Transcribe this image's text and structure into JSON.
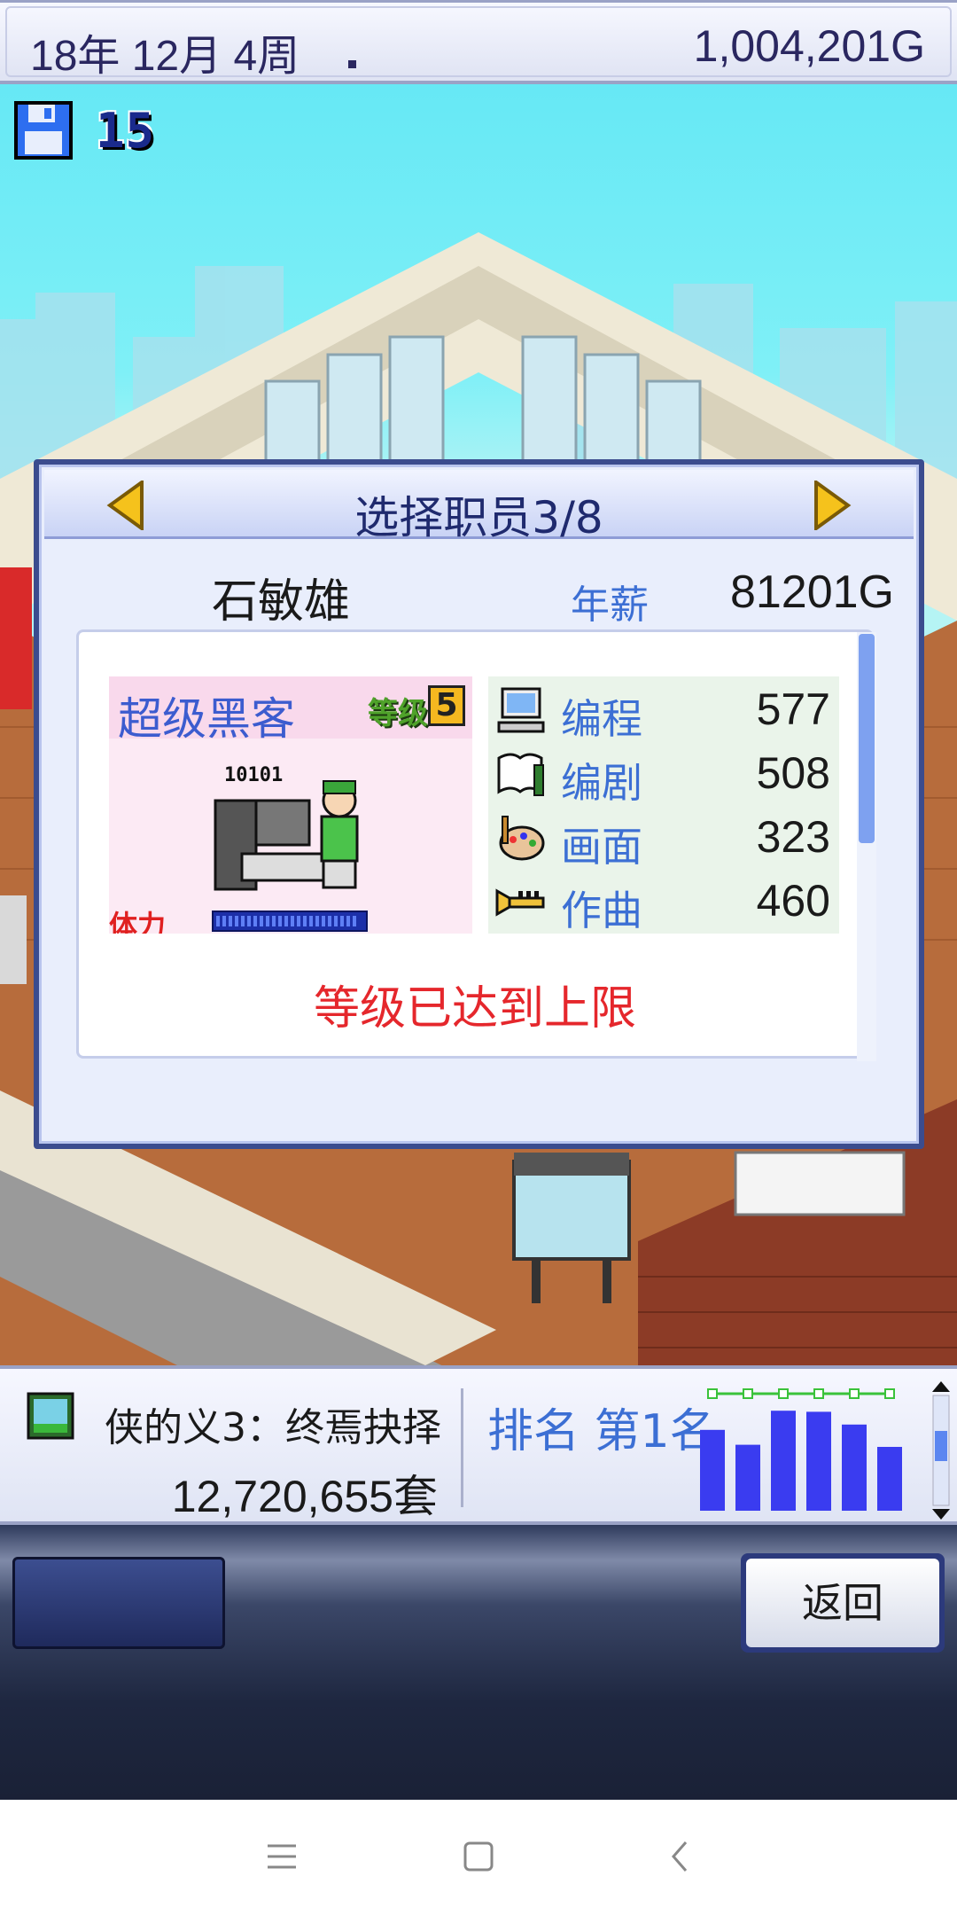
{
  "status_bar": {
    "date": "18年 12月 4周",
    "money": "1,004,201G"
  },
  "save": {
    "icon": "floppy-disk-icon",
    "count": "15"
  },
  "dialog": {
    "title": "选择职员3/8",
    "employee": {
      "name": "石敏雄",
      "salary_label": "年薪",
      "salary": "81201G",
      "job": "超级黑客",
      "level_label": "等级",
      "level": "5",
      "stamina_label": "体力",
      "stamina_fraction": 0.97,
      "art_text": "10101",
      "stats": [
        {
          "icon": "computer-icon",
          "label": "编程",
          "value": "577"
        },
        {
          "icon": "script-book-icon",
          "label": "编剧",
          "value": "508"
        },
        {
          "icon": "paint-palette-icon",
          "label": "画面",
          "value": "323"
        },
        {
          "icon": "trumpet-icon",
          "label": "作曲",
          "value": "460"
        }
      ],
      "status_message": "等级已达到上限"
    }
  },
  "info_bar": {
    "game_title": "侠的义3：终焉抉择",
    "sales": "12,720,655套",
    "rank": "排名 第1名",
    "sales_bars": [
      0.76,
      0.62,
      0.94,
      0.93,
      0.81,
      0.6
    ]
  },
  "bottom_panel": {
    "back_label": "返回"
  },
  "colors": {
    "dialog_border": "#3b4c8e",
    "stat_label": "#3c6fd4",
    "alert_red": "#e5272c",
    "bar_blue": "#3a3cf0"
  }
}
